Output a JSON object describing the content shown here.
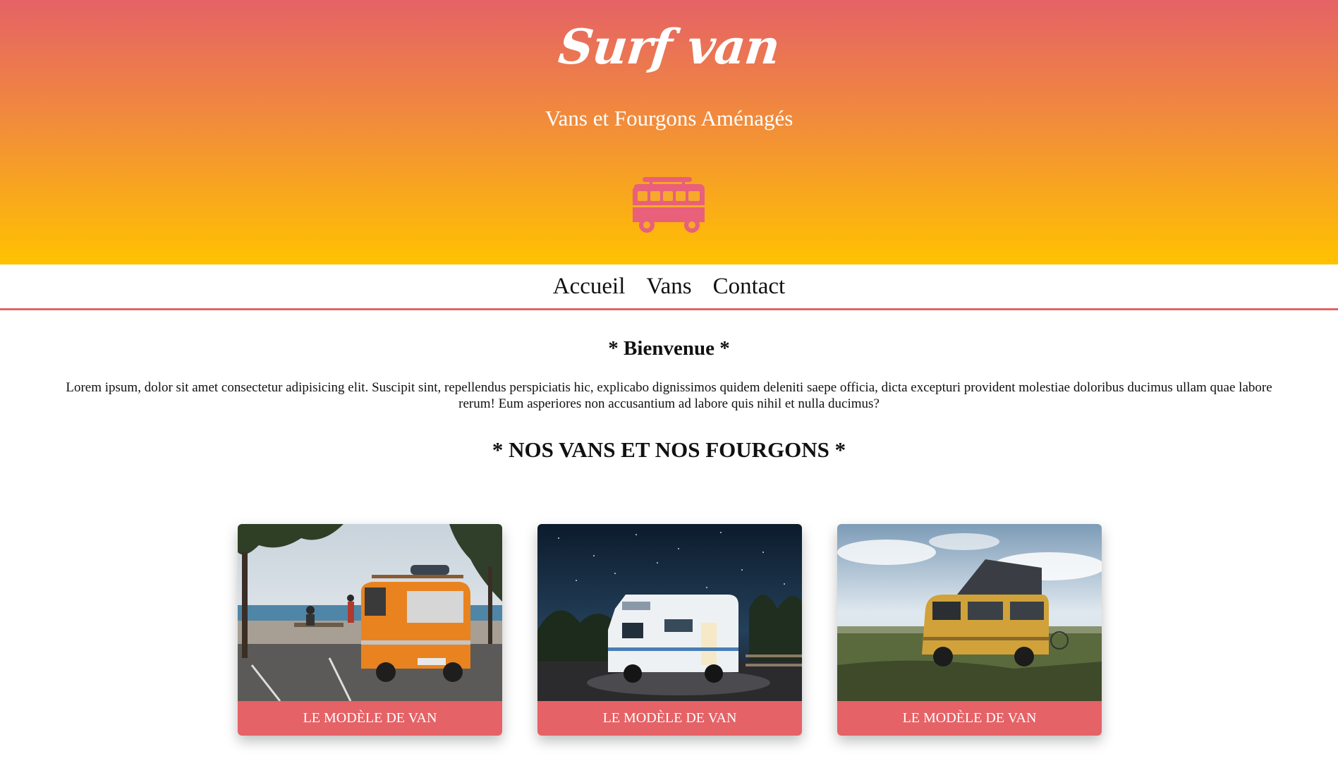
{
  "header": {
    "logo": "Surf van",
    "tagline": "Vans et Fourgons Aménagés",
    "icon": "van-icon"
  },
  "nav": {
    "items": [
      {
        "label": "Accueil"
      },
      {
        "label": "Vans"
      },
      {
        "label": "Contact"
      }
    ]
  },
  "welcome": {
    "title": "* Bienvenue *",
    "text": "Lorem ipsum, dolor sit amet consectetur adipisicing elit. Suscipit sint, repellendus perspiciatis hic, explicabo dignissimos quidem deleniti saepe officia, dicta excepturi provident molestiae doloribus ducimus ullam quae labore rerum! Eum asperiores non accusantium ad labore quis nihil et nulla ducimus?"
  },
  "vans": {
    "title": "* NOS VANS ET NOS FOURGONS *",
    "cards": [
      {
        "label": "LE MODÈLE DE VAN",
        "image": "orange-van-beach-photo"
      },
      {
        "label": "LE MODÈLE DE VAN",
        "image": "camper-night-sky-photo"
      },
      {
        "label": "LE MODÈLE DE VAN",
        "image": "yellow-van-poptop-photo"
      }
    ]
  },
  "colors": {
    "accent": "#e56266",
    "gradient_top": "#e56266",
    "gradient_bottom": "#ffc200"
  }
}
